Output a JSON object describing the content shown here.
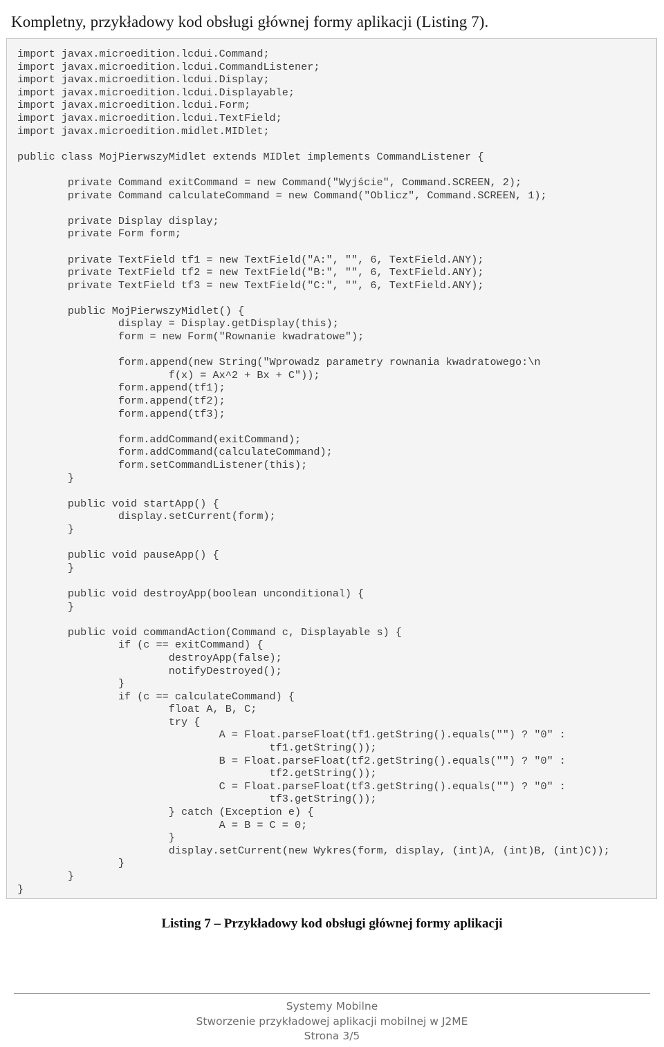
{
  "heading": "Kompletny, przykładowy kod obsługi głównej formy aplikacji (Listing 7).",
  "code_listing": {
    "language": "java",
    "lines": [
      "import javax.microedition.lcdui.Command;",
      "import javax.microedition.lcdui.CommandListener;",
      "import javax.microedition.lcdui.Display;",
      "import javax.microedition.lcdui.Displayable;",
      "import javax.microedition.lcdui.Form;",
      "import javax.microedition.lcdui.TextField;",
      "import javax.microedition.midlet.MIDlet;",
      "",
      "public class MojPierwszyMidlet extends MIDlet implements CommandListener {",
      "",
      "        private Command exitCommand = new Command(\"Wyjście\", Command.SCREEN, 2);",
      "        private Command calculateCommand = new Command(\"Oblicz\", Command.SCREEN, 1);",
      "",
      "        private Display display;",
      "        private Form form;",
      "",
      "        private TextField tf1 = new TextField(\"A:\", \"\", 6, TextField.ANY);",
      "        private TextField tf2 = new TextField(\"B:\", \"\", 6, TextField.ANY);",
      "        private TextField tf3 = new TextField(\"C:\", \"\", 6, TextField.ANY);",
      "",
      "        public MojPierwszyMidlet() {",
      "                display = Display.getDisplay(this);",
      "                form = new Form(\"Rownanie kwadratowe\");",
      "",
      "                form.append(new String(\"Wprowadz parametry rownania kwadratowego:\\n",
      "                        f(x) = Ax^2 + Bx + C\"));",
      "                form.append(tf1);",
      "                form.append(tf2);",
      "                form.append(tf3);",
      "",
      "                form.addCommand(exitCommand);",
      "                form.addCommand(calculateCommand);",
      "                form.setCommandListener(this);",
      "        }",
      "",
      "        public void startApp() {",
      "                display.setCurrent(form);",
      "        }",
      "",
      "        public void pauseApp() {",
      "        }",
      "",
      "        public void destroyApp(boolean unconditional) {",
      "        }",
      "",
      "        public void commandAction(Command c, Displayable s) {",
      "                if (c == exitCommand) {",
      "                        destroyApp(false);",
      "                        notifyDestroyed();",
      "                }",
      "                if (c == calculateCommand) {",
      "                        float A, B, C;",
      "                        try {",
      "                                A = Float.parseFloat(tf1.getString().equals(\"\") ? \"0\" :",
      "                                        tf1.getString());",
      "                                B = Float.parseFloat(tf2.getString().equals(\"\") ? \"0\" :",
      "                                        tf2.getString());",
      "                                C = Float.parseFloat(tf3.getString().equals(\"\") ? \"0\" :",
      "                                        tf3.getString());",
      "                        } catch (Exception e) {",
      "                                A = B = C = 0;",
      "                        }",
      "                        display.setCurrent(new Wykres(form, display, (int)A, (int)B, (int)C));",
      "                }",
      "        }",
      "}"
    ]
  },
  "caption": "Listing 7 – Przykładowy kod obsługi głównej formy aplikacji",
  "footer": {
    "line1": "Systemy Mobilne",
    "line2": "Stworzenie przykładowej aplikacji mobilnej w J2ME",
    "line3": "Strona 3/5"
  }
}
